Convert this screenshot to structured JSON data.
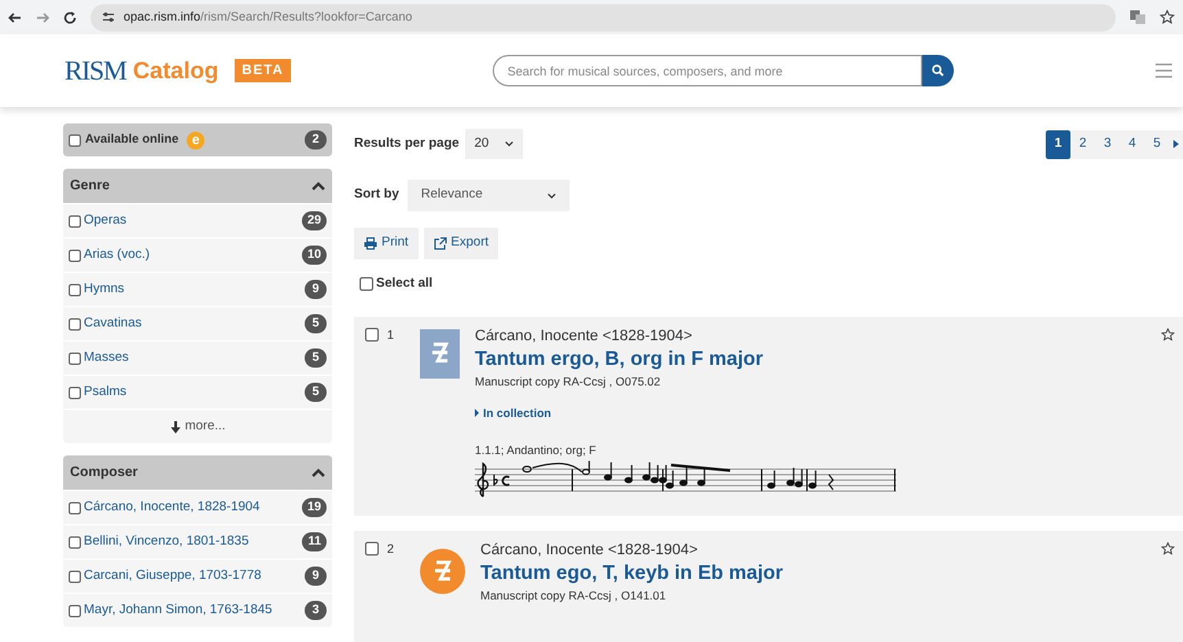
{
  "browser": {
    "url_host": "opac.rism.info",
    "url_path": "/rism/Search/Results?lookfor=Carcano"
  },
  "header": {
    "logo_mark": "RISM",
    "logo_word": "Catalog",
    "badge": "BETA",
    "search": {
      "placeholder": "Search for musical sources, composers, and more"
    }
  },
  "sidebar": {
    "available_online": {
      "label": "Available online",
      "mark": "e",
      "count": "2",
      "checked": false
    },
    "facets": [
      {
        "title": "Genre",
        "expanded": true,
        "items": [
          {
            "label": "Operas",
            "count": "29",
            "checked": false
          },
          {
            "label": "Arias (voc.)",
            "count": "10",
            "checked": false
          },
          {
            "label": "Hymns",
            "count": "9",
            "checked": false
          },
          {
            "label": "Cavatinas",
            "count": "5",
            "checked": false
          },
          {
            "label": "Masses",
            "count": "5",
            "checked": false
          },
          {
            "label": "Psalms",
            "count": "5",
            "checked": false
          }
        ],
        "more": "more..."
      },
      {
        "title": "Composer",
        "expanded": true,
        "items": [
          {
            "label": "Cárcano, Inocente, 1828-1904",
            "count": "19",
            "checked": false
          },
          {
            "label": "Bellini, Vincenzo, 1801-1835",
            "count": "11",
            "checked": false
          },
          {
            "label": "Carcani, Giuseppe, 1703-1778",
            "count": "9",
            "checked": false
          },
          {
            "label": "Mayr, Johann Simon, 1763-1845",
            "count": "3",
            "checked": false
          }
        ]
      }
    ]
  },
  "results_per_page": {
    "label": "Results per page",
    "value": "20"
  },
  "pagination": [
    {
      "label": "1",
      "selected": true
    },
    {
      "label": "2",
      "selected": false
    },
    {
      "label": "3",
      "selected": false
    },
    {
      "label": "4",
      "selected": false
    },
    {
      "label": "5",
      "selected": false
    }
  ],
  "sort": {
    "label": "Sort by",
    "value": "Relevance"
  },
  "actions": [
    {
      "kind": "print",
      "label": "Print"
    },
    {
      "kind": "export",
      "label": "Export"
    }
  ],
  "select_all": {
    "label": "Select all",
    "checked": false
  },
  "results": [
    {
      "number": "1",
      "checked": false,
      "kind": "collection",
      "composer": "Cárcano, Inocente <1828-1904>",
      "title": "Tantum ergo, B, org in F major",
      "source": "Manuscript copy RA-Ccsj , O075.02",
      "in_collection": "In collection",
      "incipit": "1.1.1; Andantino; org; F",
      "starred": false
    },
    {
      "number": "2",
      "checked": false,
      "kind": "item",
      "composer": "Cárcano, Inocente <1828-1904>",
      "title": "Tantum ego, T, keyb in Eb major",
      "source": "Manuscript copy RA-Ccsj , O141.01",
      "starred": false
    }
  ]
}
